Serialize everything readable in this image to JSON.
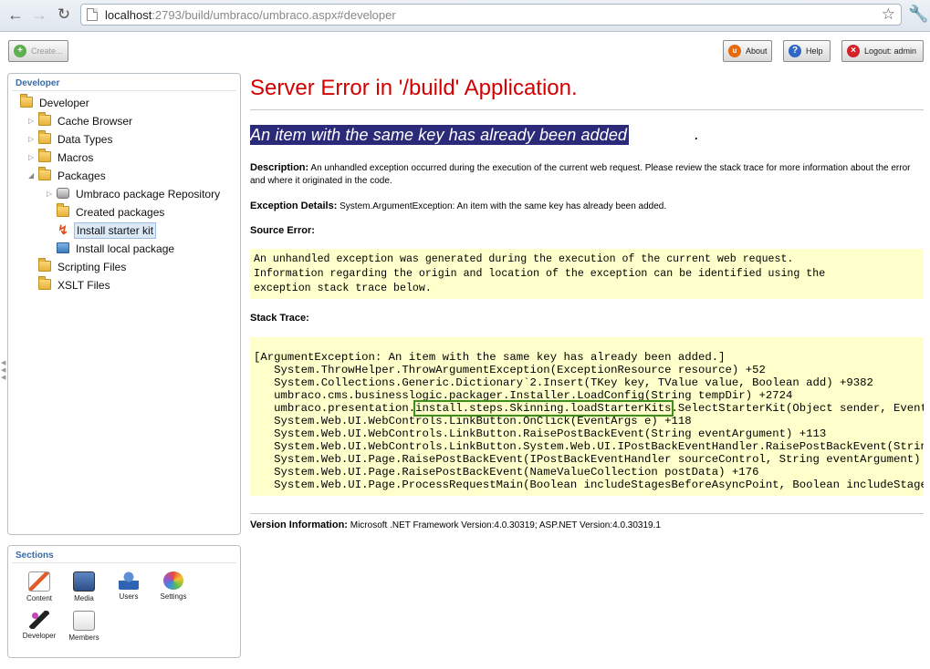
{
  "browser": {
    "url_host": "localhost",
    "url_rest": ":2793/build/umbraco/umbraco.aspx#developer"
  },
  "toolbar": {
    "create_label": "Create...",
    "about_label": "About",
    "help_label": "Help",
    "logout_label": "Logout: admin"
  },
  "tree": {
    "header": "Developer",
    "nodes": [
      {
        "label": "Developer"
      },
      {
        "label": "Cache Browser"
      },
      {
        "label": "Data Types"
      },
      {
        "label": "Macros"
      },
      {
        "label": "Packages"
      },
      {
        "label": "Umbraco package Repository"
      },
      {
        "label": "Created packages"
      },
      {
        "label": "Install starter kit"
      },
      {
        "label": "Install local package"
      },
      {
        "label": "Scripting Files"
      },
      {
        "label": "XSLT Files"
      }
    ]
  },
  "sections": {
    "header": "Sections",
    "items": [
      {
        "label": "Content",
        "icon": "content-icon"
      },
      {
        "label": "Media",
        "icon": "media-icon"
      },
      {
        "label": "Users",
        "icon": "users-icon"
      },
      {
        "label": "Settings",
        "icon": "settings-icon"
      },
      {
        "label": "Developer",
        "icon": "developer-icon"
      },
      {
        "label": "Members",
        "icon": "members-icon"
      }
    ]
  },
  "error": {
    "title": "Server Error in '/build' Application.",
    "heading": "An item with the same key has already been added",
    "heading_end": ".",
    "description_label": "Description:",
    "description_text": "An unhandled exception occurred during the execution of the current web request. Please review the stack trace for more information about the error and where it originated in the code.",
    "exception_label": "Exception Details:",
    "exception_text": "System.ArgumentException: An item with the same key has already been added.",
    "source_label": "Source Error:",
    "source_lines": [
      "An unhandled exception was generated during the execution of the current web request.",
      "Information regarding the origin and location of the exception can be identified using the",
      "exception stack trace below."
    ],
    "stack_label": "Stack Trace:",
    "stack_lines": [
      "[ArgumentException: An item with the same key has already been added.]",
      "   System.ThrowHelper.ThrowArgumentException(ExceptionResource resource) +52",
      "   System.Collections.Generic.Dictionary`2.Insert(TKey key, TValue value, Boolean add) +9382",
      "   umbraco.cms.businesslogic.packager.Installer.LoadConfig(String tempDir) +2724"
    ],
    "stack_hl_prefix": "   umbraco.presentation.",
    "stack_hl_text": "install.steps.Skinning.loadStarterKits",
    "stack_hl_suffix": ".SelectStarterKit(Object sender, EventArgs e)",
    "stack_lines_after": [
      "   System.Web.UI.WebControls.LinkButton.OnClick(EventArgs e) +118",
      "   System.Web.UI.WebControls.LinkButton.RaisePostBackEvent(String eventArgument) +113",
      "   System.Web.UI.WebControls.LinkButton.System.Web.UI.IPostBackEventHandler.RaisePostBackEvent(String eventArgument)",
      "   System.Web.UI.Page.RaisePostBackEvent(IPostBackEventHandler sourceControl, String eventArgument)",
      "   System.Web.UI.Page.RaisePostBackEvent(NameValueCollection postData) +176",
      "   System.Web.UI.Page.ProcessRequestMain(Boolean includeStagesBeforeAsyncPoint, Boolean includeStagesAfterAsyncPoint)"
    ],
    "version_label": "Version Information:",
    "version_text": "Microsoft .NET Framework Version:4.0.30319; ASP.NET Version:4.0.30319.1"
  }
}
